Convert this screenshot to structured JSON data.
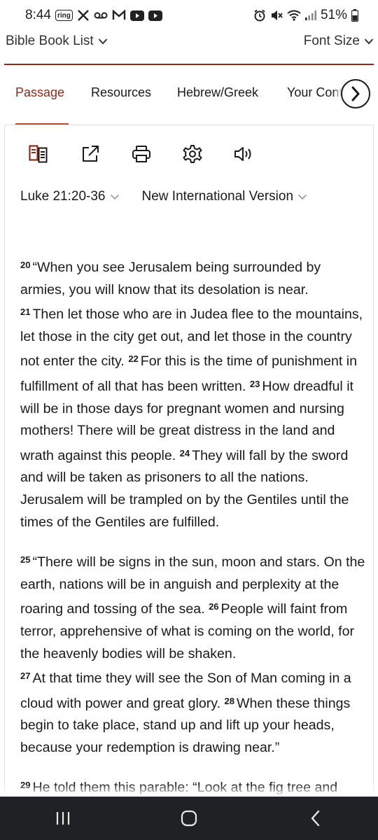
{
  "status_bar": {
    "time": "8:44",
    "ring_label": "ring",
    "battery": "51%"
  },
  "top_bar": {
    "book_list": "Bible Book List",
    "font_size": "Font Size"
  },
  "tabs": [
    {
      "label": "Passage",
      "active": true
    },
    {
      "label": "Resources"
    },
    {
      "label": "Hebrew/Greek"
    },
    {
      "label": "Your Content"
    }
  ],
  "toolbar_icons": [
    "parallel-icon",
    "share-icon",
    "print-icon",
    "settings-icon",
    "audio-icon"
  ],
  "selectors": {
    "passage": "Luke 21:20-36",
    "version": "New International Version"
  },
  "scripture": {
    "p1": [
      {
        "n": "20",
        "t": "“When you see Jerusalem being surrounded by armies, you will know that its desolation is near."
      },
      {
        "n": "21",
        "t": "Then let those who are in Judea flee to the mountains, let those in the city get out, and let those in the country not enter the city."
      },
      {
        "n": "22",
        "t": "For this is the time of punishment in fulfillment of all that has been written."
      },
      {
        "n": "23",
        "t": "How dreadful it will be in those days for pregnant women and nursing mothers! There will be great distress in the land and wrath against this people."
      },
      {
        "n": "24",
        "t": "They will fall by the sword and will be taken as prisoners to all the nations. Jerusalem will be trampled on by the Gentiles until the times of the Gentiles are fulfilled."
      }
    ],
    "p2": [
      {
        "n": "25",
        "t": "“There will be signs in the sun, moon and stars. On the earth, nations will be in anguish and perplexity at the roaring and tossing of the sea."
      },
      {
        "n": "26",
        "t": "People will faint from terror, apprehensive of what is coming on the world, for the heavenly bodies will be shaken."
      },
      {
        "n": "27",
        "t": "At that time they will see the Son of Man coming in a cloud with power and great glory."
      },
      {
        "n": "28",
        "t": "When these things begin to take place, stand up and lift up your heads, because your redemption is drawing near.”"
      }
    ],
    "p3": [
      {
        "n": "29",
        "t": "He told them this parable: “Look at the fig tree and"
      }
    ]
  },
  "colors": {
    "accent": "#8b2a1d",
    "nav_bar": "#202124"
  }
}
